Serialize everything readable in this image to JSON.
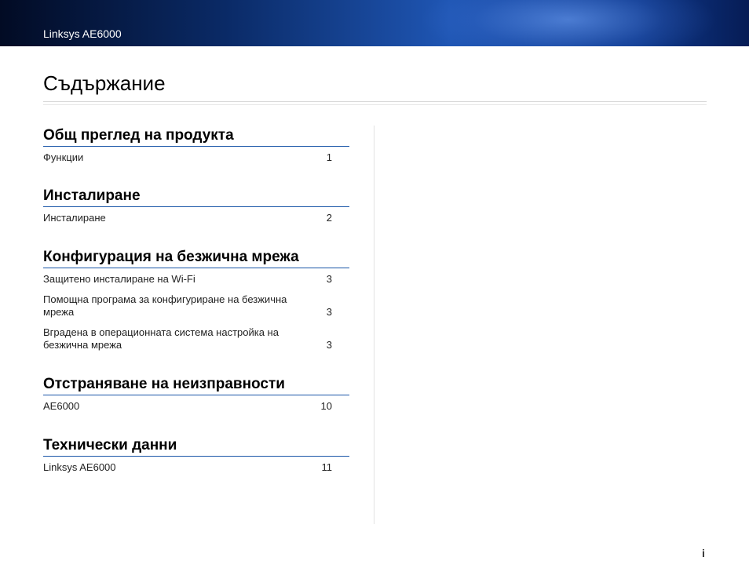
{
  "header": {
    "product_name": "Linksys AE6000"
  },
  "page": {
    "title": "Съдържание",
    "number": "i"
  },
  "toc": [
    {
      "heading": "Общ преглед на продукта",
      "entries": [
        {
          "label": "Функции",
          "page": "1"
        }
      ]
    },
    {
      "heading": "Инсталиране",
      "entries": [
        {
          "label": "Инсталиране",
          "page": "2"
        }
      ]
    },
    {
      "heading": "Конфигурация на безжична мрежа",
      "entries": [
        {
          "label": "Защитено инсталиране на Wi-Fi",
          "page": "3"
        },
        {
          "label": "Помощна програма за конфигуриране на безжична мрежа",
          "page": "3"
        },
        {
          "label": "Вградена в операционната система настройка на безжична мрежа",
          "page": "3"
        }
      ]
    },
    {
      "heading": "Отстраняване на неизправности",
      "entries": [
        {
          "label": "AE6000",
          "page": "10"
        }
      ]
    },
    {
      "heading": "Технически данни",
      "entries": [
        {
          "label": "Linksys AE6000",
          "page": "11"
        }
      ]
    }
  ]
}
